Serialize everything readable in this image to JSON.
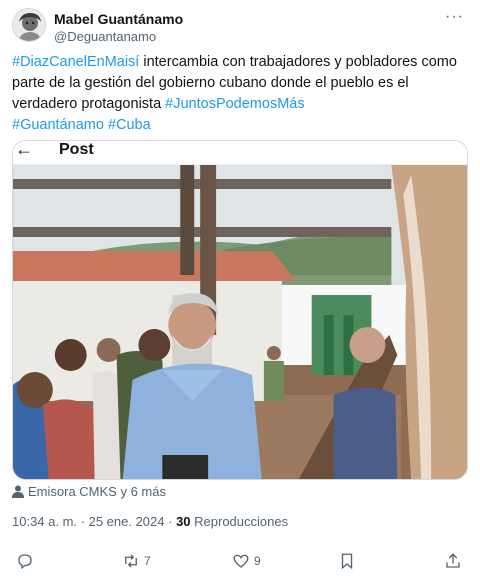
{
  "author": {
    "name": "Mabel Guantánamo",
    "handle": "@Deguantanamo"
  },
  "tweet": {
    "hashtag_1": "#DiazCanelEnMaisí",
    "text_1": " intercambia con trabajadores y pobladores como parte de la gestión del gobierno cubano donde el pueblo es el verdadero protagonista ",
    "hashtag_2": "#JuntosPodemosMás",
    "hashtag_3": "#Guantánamo",
    "hashtag_4": "#Cuba"
  },
  "embedded_card": {
    "title": "Post"
  },
  "media_credit": "Emisora CMKS y 6 más",
  "meta": {
    "time": "10:34 a. m. · 25 ene. 2024 · ",
    "views_count": "30",
    "views_label": " Reproducciones"
  },
  "actions": {
    "reposts": "7",
    "likes": "9"
  },
  "colors": {
    "link": "#1d9bf0",
    "muted": "#536471",
    "text": "#0f1419"
  },
  "icons": [
    "more-icon",
    "back-arrow-icon",
    "person-icon",
    "reply-icon",
    "repost-icon",
    "like-icon",
    "bookmark-icon",
    "share-icon"
  ]
}
